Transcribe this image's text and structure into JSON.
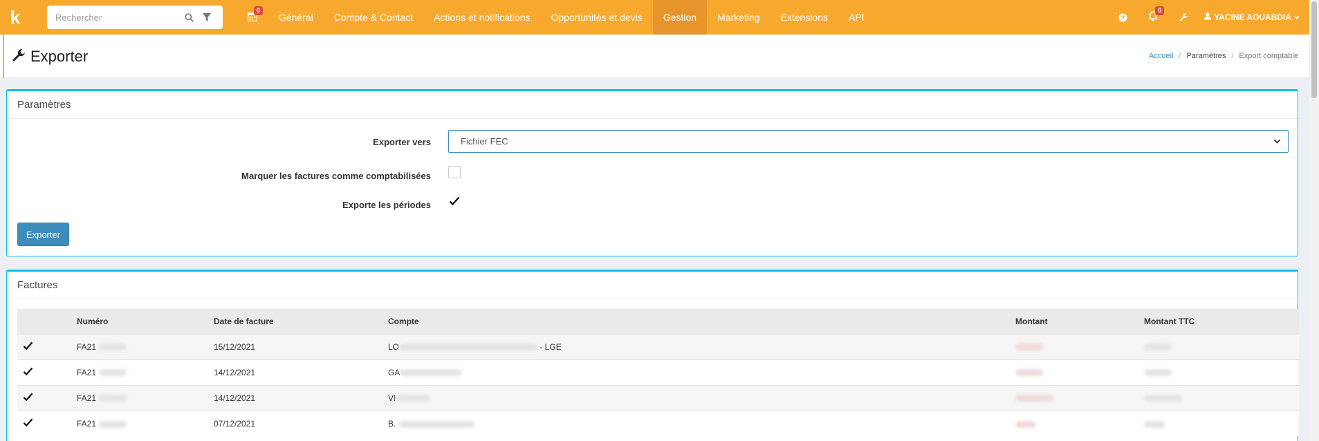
{
  "topnav": {
    "logo_text": "k",
    "search_placeholder": "Rechercher",
    "calendar_badge": "0",
    "items": [
      {
        "label": "Général"
      },
      {
        "label": "Compte & Contact"
      },
      {
        "label": "Actions et notifications"
      },
      {
        "label": "Opportunités et devis"
      },
      {
        "label": "Gestion",
        "active": true
      },
      {
        "label": "Marketing"
      },
      {
        "label": "Extensions"
      },
      {
        "label": "API"
      }
    ],
    "notifications_badge": "0",
    "user_name": "YACINE AOUABDIA",
    "brand_color": "#f7a92d"
  },
  "header": {
    "title": "Exporter",
    "breadcrumb": {
      "home": "Accueil",
      "section": "Paramètres",
      "current": "Export comptable"
    }
  },
  "params": {
    "title": "Paramètres",
    "export_to_label": "Exporter vers",
    "export_to_value": "Fichier FEC",
    "mark_label": "Marquer les factures comme comptabilisées",
    "mark_checked": false,
    "periods_label": "Exporte les périodes",
    "periods_checked": true,
    "export_button": "Exporter"
  },
  "invoices": {
    "title": "Factures",
    "columns": [
      "",
      "Numéro",
      "Date de facture",
      "Compte",
      "Montant",
      "Montant TTC"
    ],
    "rows": [
      {
        "checked": true,
        "numero": "FA21",
        "date": "15/12/2021",
        "compte_prefix": "LO",
        "compte_suffix": " - LGE"
      },
      {
        "checked": true,
        "numero": "FA21",
        "date": "14/12/2021",
        "compte_prefix": "GA",
        "compte_suffix": ""
      },
      {
        "checked": true,
        "numero": "FA21",
        "date": "14/12/2021",
        "compte_prefix": "VI",
        "compte_suffix": ""
      },
      {
        "checked": true,
        "numero": "FA21",
        "date": "07/12/2021",
        "compte_prefix": "B.",
        "compte_suffix": ""
      }
    ]
  }
}
